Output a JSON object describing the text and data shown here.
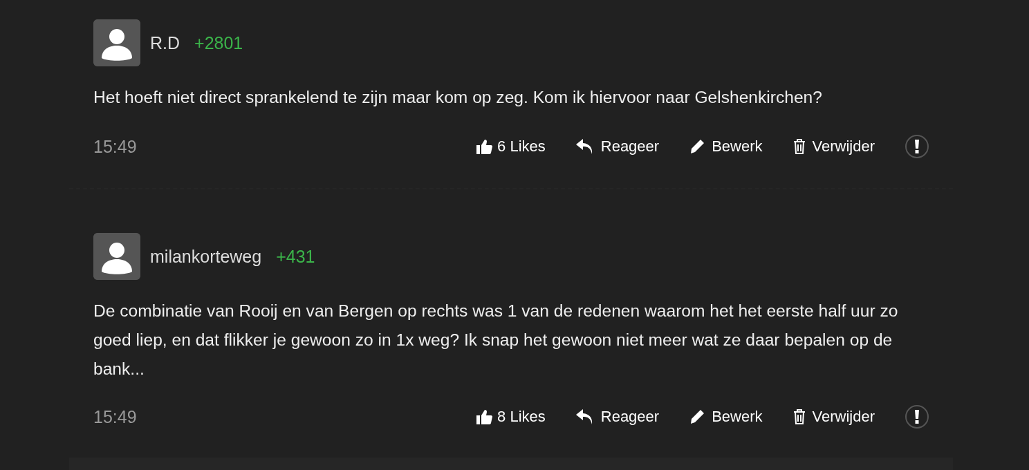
{
  "comments": [
    {
      "username": "R.D",
      "score": "+2801",
      "text": "Het hoeft niet direct sprankelend te zijn maar kom op zeg. Kom ik hiervoor naar Gelshenkirchen?",
      "time": "15:49",
      "actions": [
        {
          "kind": "like",
          "label": "6 Likes"
        },
        {
          "kind": "reply",
          "label": "Reageer"
        },
        {
          "kind": "edit",
          "label": "Bewerk"
        },
        {
          "kind": "delete",
          "label": "Verwijder"
        }
      ]
    },
    {
      "username": "milankorteweg",
      "score": "+431",
      "text": "De combinatie van Rooij en van Bergen op rechts was 1 van de redenen waarom het het eerste half uur zo goed liep, en dat flikker je gewoon zo in 1x weg? Ik snap het gewoon niet meer wat ze daar bepalen op de bank...",
      "time": "15:49",
      "actions": [
        {
          "kind": "like",
          "label": "8 Likes"
        },
        {
          "kind": "reply",
          "label": "Reageer"
        },
        {
          "kind": "edit",
          "label": "Bewerk"
        },
        {
          "kind": "delete",
          "label": "Verwijder"
        }
      ]
    }
  ]
}
